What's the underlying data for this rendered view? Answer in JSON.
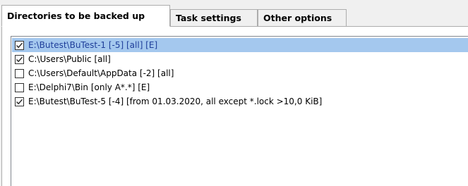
{
  "tabs": [
    {
      "label": "Directories to be backed up",
      "active": true
    },
    {
      "label": "Task settings",
      "active": false
    },
    {
      "label": "Other options",
      "active": false
    }
  ],
  "directories": [
    {
      "label": "E:\\Butest\\BuTest-1 [-5] [all] [E]",
      "checked": true,
      "selected": true
    },
    {
      "label": "C:\\Users\\Public [all]",
      "checked": true,
      "selected": false
    },
    {
      "label": "C:\\Users\\Default\\AppData [-2] [all]",
      "checked": false,
      "selected": false
    },
    {
      "label": "E:\\Delphi7\\Bin [only A*.*] [E]",
      "checked": false,
      "selected": false
    },
    {
      "label": "E:\\Butest\\BuTest-5 [-4] [from 01.03.2020, all except *.lock >10,0 KiB]",
      "checked": true,
      "selected": false
    }
  ],
  "colors": {
    "selection_bg": "#a4c8ee",
    "selection_text": "#1e3e9a"
  },
  "icons": {
    "checkbox_checked": "checkmark-icon"
  }
}
